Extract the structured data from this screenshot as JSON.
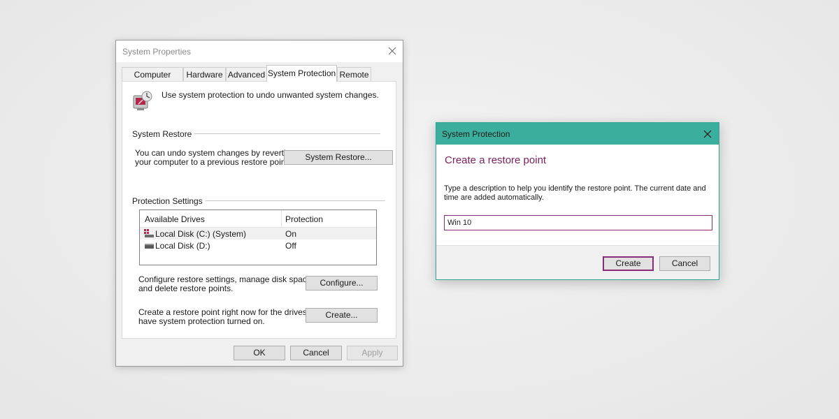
{
  "system_properties": {
    "title": "System Properties",
    "tabs": [
      {
        "label": "Computer Name"
      },
      {
        "label": "Hardware"
      },
      {
        "label": "Advanced"
      },
      {
        "label": "System Protection",
        "active": true
      },
      {
        "label": "Remote"
      }
    ],
    "intro_text": "Use system protection to undo unwanted system changes.",
    "system_restore": {
      "group_label": "System Restore",
      "description_line1": "You can undo system changes by reverting",
      "description_line2": "your computer to a previous restore point.",
      "button_label": "System Restore..."
    },
    "protection_settings": {
      "group_label": "Protection Settings",
      "columns": {
        "drives": "Available Drives",
        "protection": "Protection"
      },
      "drives": [
        {
          "name": "Local Disk (C:) (System)",
          "protection": "On",
          "icon": "system-drive-icon",
          "selected": true
        },
        {
          "name": "Local Disk (D:)",
          "protection": "Off",
          "icon": "drive-icon",
          "selected": false
        }
      ],
      "configure_text_line1": "Configure restore settings, manage disk space,",
      "configure_text_line2": "and delete restore points.",
      "configure_button": "Configure...",
      "create_text_line1": "Create a restore point right now for the drives that",
      "create_text_line2": "have system protection turned on.",
      "create_button": "Create..."
    },
    "footer": {
      "ok": "OK",
      "cancel": "Cancel",
      "apply": "Apply"
    }
  },
  "protection_dialog": {
    "title": "System Protection",
    "heading": "Create a restore point",
    "description_line1": "Type a description to help you identify the restore point. The current date and",
    "description_line2": "time are added automatically.",
    "input_value": "Win 10",
    "create_button": "Create",
    "cancel_button": "Cancel",
    "accent_color": "#3cae9d",
    "heading_color": "#7a1f5a"
  }
}
